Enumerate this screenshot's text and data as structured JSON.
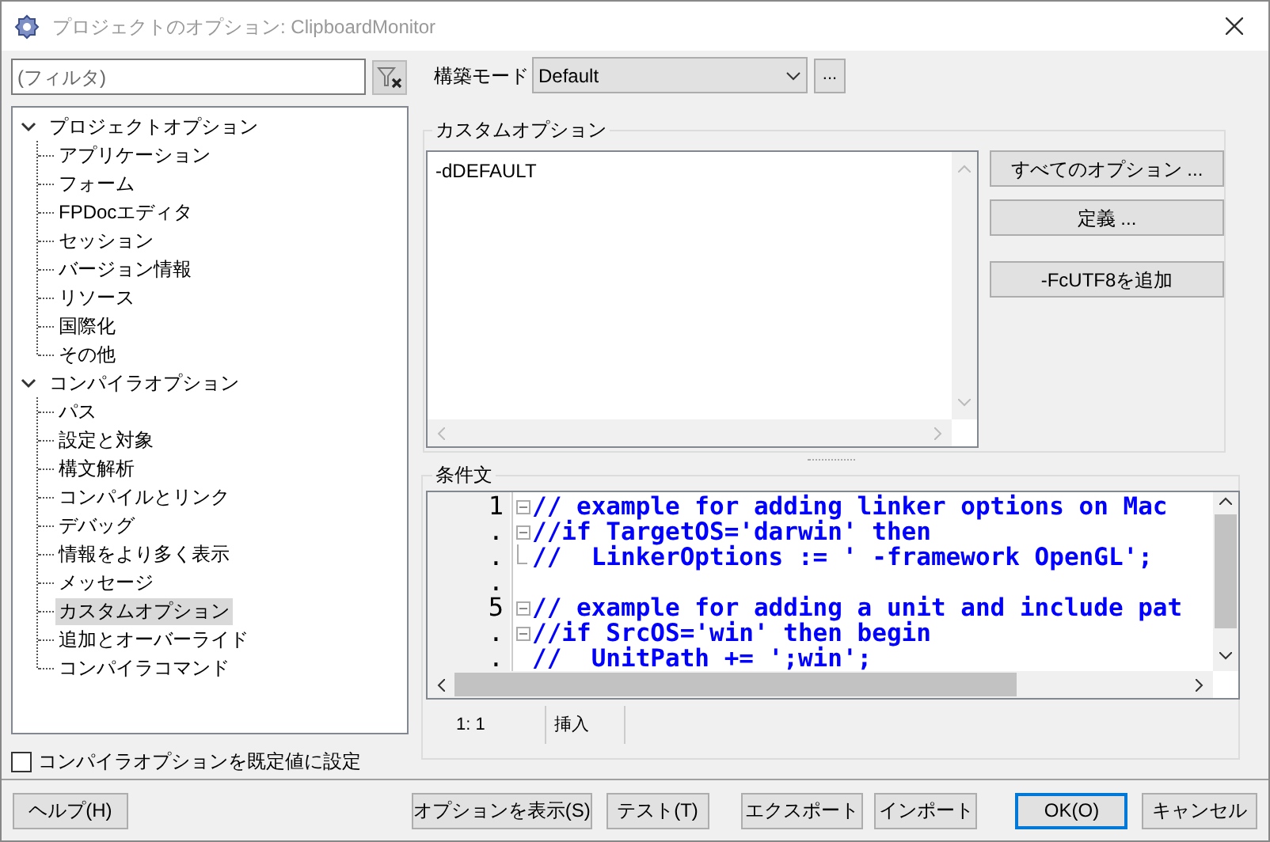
{
  "window": {
    "title": "プロジェクトのオプション: ClipboardMonitor"
  },
  "filter": {
    "placeholder": "(フィルタ)"
  },
  "tree": [
    {
      "label": "プロジェクトオプション",
      "expanded": true,
      "selected": false,
      "children": [
        {
          "label": "アプリケーション",
          "selected": false
        },
        {
          "label": "フォーム",
          "selected": false
        },
        {
          "label": "FPDocエディタ",
          "selected": false
        },
        {
          "label": "セッション",
          "selected": false
        },
        {
          "label": "バージョン情報",
          "selected": false
        },
        {
          "label": "リソース",
          "selected": false
        },
        {
          "label": "国際化",
          "selected": false
        },
        {
          "label": "その他",
          "selected": false
        }
      ]
    },
    {
      "label": "コンパイラオプション",
      "expanded": true,
      "selected": false,
      "children": [
        {
          "label": "パス",
          "selected": false
        },
        {
          "label": "設定と対象",
          "selected": false
        },
        {
          "label": "構文解析",
          "selected": false
        },
        {
          "label": "コンパイルとリンク",
          "selected": false
        },
        {
          "label": "デバッグ",
          "selected": false
        },
        {
          "label": "情報をより多く表示",
          "selected": false
        },
        {
          "label": "メッセージ",
          "selected": false
        },
        {
          "label": "カスタムオプション",
          "selected": true
        },
        {
          "label": "追加とオーバーライド",
          "selected": false
        },
        {
          "label": "コンパイラコマンド",
          "selected": false
        }
      ]
    }
  ],
  "set_defaults": {
    "label": "コンパイラオプションを既定値に設定",
    "checked": false
  },
  "build_mode": {
    "label": "構築モード",
    "value": "Default",
    "more_button": "..."
  },
  "custom_options": {
    "title": "カスタムオプション",
    "text": "-dDEFAULT",
    "buttons": [
      "すべてのオプション ...",
      "定義 ...",
      "-FcUTF8を追加"
    ]
  },
  "conditionals": {
    "title": "条件文",
    "lines": [
      {
        "number": "1",
        "kind": "start",
        "code": "// example for adding linker options on Mac"
      },
      {
        "number": ".",
        "kind": "start",
        "code": "//if TargetOS='darwin' then"
      },
      {
        "number": ".",
        "kind": "end",
        "code": "//  LinkerOptions := ' -framework OpenGL';"
      },
      {
        "number": ".",
        "kind": "plain"
      },
      {
        "number": "5",
        "kind": "start",
        "code": "// example for adding a unit and include pat"
      },
      {
        "number": ".",
        "kind": "start",
        "code": "//if SrcOS='win' then begin"
      },
      {
        "number": ".",
        "kind": "plain",
        "code": "//  UnitPath += ';win';"
      }
    ],
    "status": {
      "position": "1:  1",
      "mode": "挿入"
    }
  },
  "buttons": [
    {
      "label": "ヘルプ(H)",
      "default": false
    },
    {
      "label": "オプションを表示(S)",
      "default": false
    },
    {
      "label": "テスト(T)",
      "default": false
    },
    {
      "label": "エクスポート",
      "default": false
    },
    {
      "label": "インポート",
      "default": false
    },
    {
      "label": "OK(O)",
      "default": true
    },
    {
      "label": "キャンセル",
      "default": false
    }
  ]
}
